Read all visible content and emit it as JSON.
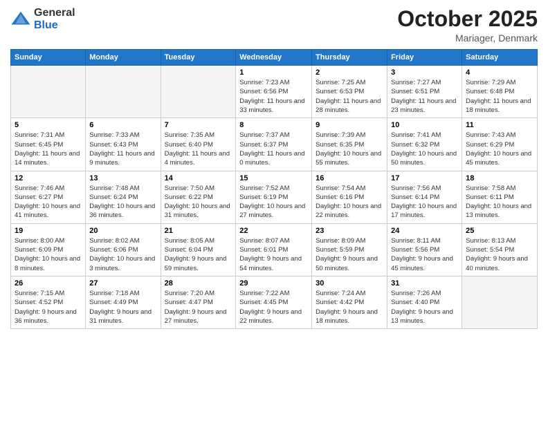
{
  "logo": {
    "general": "General",
    "blue": "Blue"
  },
  "header": {
    "month": "October 2025",
    "location": "Mariager, Denmark"
  },
  "weekdays": [
    "Sunday",
    "Monday",
    "Tuesday",
    "Wednesday",
    "Thursday",
    "Friday",
    "Saturday"
  ],
  "weeks": [
    [
      {
        "day": "",
        "info": ""
      },
      {
        "day": "",
        "info": ""
      },
      {
        "day": "",
        "info": ""
      },
      {
        "day": "1",
        "info": "Sunrise: 7:23 AM\nSunset: 6:56 PM\nDaylight: 11 hours and 33 minutes."
      },
      {
        "day": "2",
        "info": "Sunrise: 7:25 AM\nSunset: 6:53 PM\nDaylight: 11 hours and 28 minutes."
      },
      {
        "day": "3",
        "info": "Sunrise: 7:27 AM\nSunset: 6:51 PM\nDaylight: 11 hours and 23 minutes."
      },
      {
        "day": "4",
        "info": "Sunrise: 7:29 AM\nSunset: 6:48 PM\nDaylight: 11 hours and 18 minutes."
      }
    ],
    [
      {
        "day": "5",
        "info": "Sunrise: 7:31 AM\nSunset: 6:45 PM\nDaylight: 11 hours and 14 minutes."
      },
      {
        "day": "6",
        "info": "Sunrise: 7:33 AM\nSunset: 6:43 PM\nDaylight: 11 hours and 9 minutes."
      },
      {
        "day": "7",
        "info": "Sunrise: 7:35 AM\nSunset: 6:40 PM\nDaylight: 11 hours and 4 minutes."
      },
      {
        "day": "8",
        "info": "Sunrise: 7:37 AM\nSunset: 6:37 PM\nDaylight: 11 hours and 0 minutes."
      },
      {
        "day": "9",
        "info": "Sunrise: 7:39 AM\nSunset: 6:35 PM\nDaylight: 10 hours and 55 minutes."
      },
      {
        "day": "10",
        "info": "Sunrise: 7:41 AM\nSunset: 6:32 PM\nDaylight: 10 hours and 50 minutes."
      },
      {
        "day": "11",
        "info": "Sunrise: 7:43 AM\nSunset: 6:29 PM\nDaylight: 10 hours and 45 minutes."
      }
    ],
    [
      {
        "day": "12",
        "info": "Sunrise: 7:46 AM\nSunset: 6:27 PM\nDaylight: 10 hours and 41 minutes."
      },
      {
        "day": "13",
        "info": "Sunrise: 7:48 AM\nSunset: 6:24 PM\nDaylight: 10 hours and 36 minutes."
      },
      {
        "day": "14",
        "info": "Sunrise: 7:50 AM\nSunset: 6:22 PM\nDaylight: 10 hours and 31 minutes."
      },
      {
        "day": "15",
        "info": "Sunrise: 7:52 AM\nSunset: 6:19 PM\nDaylight: 10 hours and 27 minutes."
      },
      {
        "day": "16",
        "info": "Sunrise: 7:54 AM\nSunset: 6:16 PM\nDaylight: 10 hours and 22 minutes."
      },
      {
        "day": "17",
        "info": "Sunrise: 7:56 AM\nSunset: 6:14 PM\nDaylight: 10 hours and 17 minutes."
      },
      {
        "day": "18",
        "info": "Sunrise: 7:58 AM\nSunset: 6:11 PM\nDaylight: 10 hours and 13 minutes."
      }
    ],
    [
      {
        "day": "19",
        "info": "Sunrise: 8:00 AM\nSunset: 6:09 PM\nDaylight: 10 hours and 8 minutes."
      },
      {
        "day": "20",
        "info": "Sunrise: 8:02 AM\nSunset: 6:06 PM\nDaylight: 10 hours and 3 minutes."
      },
      {
        "day": "21",
        "info": "Sunrise: 8:05 AM\nSunset: 6:04 PM\nDaylight: 9 hours and 59 minutes."
      },
      {
        "day": "22",
        "info": "Sunrise: 8:07 AM\nSunset: 6:01 PM\nDaylight: 9 hours and 54 minutes."
      },
      {
        "day": "23",
        "info": "Sunrise: 8:09 AM\nSunset: 5:59 PM\nDaylight: 9 hours and 50 minutes."
      },
      {
        "day": "24",
        "info": "Sunrise: 8:11 AM\nSunset: 5:56 PM\nDaylight: 9 hours and 45 minutes."
      },
      {
        "day": "25",
        "info": "Sunrise: 8:13 AM\nSunset: 5:54 PM\nDaylight: 9 hours and 40 minutes."
      }
    ],
    [
      {
        "day": "26",
        "info": "Sunrise: 7:15 AM\nSunset: 4:52 PM\nDaylight: 9 hours and 36 minutes."
      },
      {
        "day": "27",
        "info": "Sunrise: 7:18 AM\nSunset: 4:49 PM\nDaylight: 9 hours and 31 minutes."
      },
      {
        "day": "28",
        "info": "Sunrise: 7:20 AM\nSunset: 4:47 PM\nDaylight: 9 hours and 27 minutes."
      },
      {
        "day": "29",
        "info": "Sunrise: 7:22 AM\nSunset: 4:45 PM\nDaylight: 9 hours and 22 minutes."
      },
      {
        "day": "30",
        "info": "Sunrise: 7:24 AM\nSunset: 4:42 PM\nDaylight: 9 hours and 18 minutes."
      },
      {
        "day": "31",
        "info": "Sunrise: 7:26 AM\nSunset: 4:40 PM\nDaylight: 9 hours and 13 minutes."
      },
      {
        "day": "",
        "info": ""
      }
    ]
  ]
}
